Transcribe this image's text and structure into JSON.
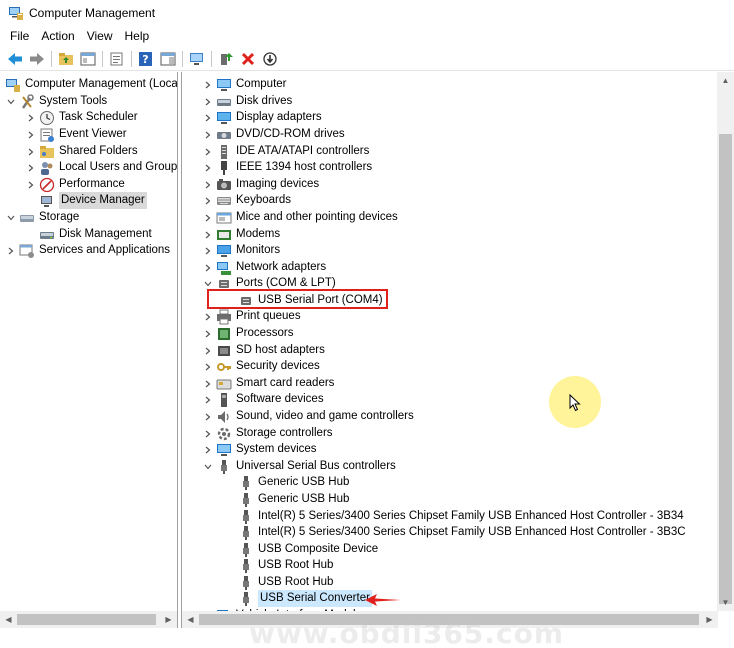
{
  "window": {
    "title": "Computer Management"
  },
  "menu": [
    "File",
    "Action",
    "View",
    "Help"
  ],
  "left_tree": {
    "root": "Computer Management (Local",
    "system_tools": "System Tools",
    "task_scheduler": "Task Scheduler",
    "event_viewer": "Event Viewer",
    "shared_folders": "Shared Folders",
    "local_users": "Local Users and Groups",
    "performance": "Performance",
    "device_manager": "Device Manager",
    "storage": "Storage",
    "disk_management": "Disk Management",
    "services": "Services and Applications"
  },
  "device_tree": {
    "computer": "Computer",
    "disk_drives": "Disk drives",
    "display_adapters": "Display adapters",
    "dvd": "DVD/CD-ROM drives",
    "ide": "IDE ATA/ATAPI controllers",
    "ieee": "IEEE 1394 host controllers",
    "imaging": "Imaging devices",
    "keyboards": "Keyboards",
    "mice": "Mice and other pointing devices",
    "modems": "Modems",
    "monitors": "Monitors",
    "network": "Network adapters",
    "ports": "Ports (COM & LPT)",
    "usb_serial_port": "USB Serial Port (COM4)",
    "print_queues": "Print queues",
    "processors": "Processors",
    "sd_host": "SD host adapters",
    "security": "Security devices",
    "smart_card": "Smart card readers",
    "software": "Software devices",
    "sound": "Sound, video and game controllers",
    "storage_controllers": "Storage controllers",
    "system_devices": "System devices",
    "usb_controllers": "Universal Serial Bus controllers",
    "generic_hub_1": "Generic USB Hub",
    "generic_hub_2": "Generic USB Hub",
    "intel_3b34": "Intel(R) 5 Series/3400 Series Chipset Family USB Enhanced Host Controller - 3B34",
    "intel_3b3c": "Intel(R) 5 Series/3400 Series Chipset Family USB Enhanced Host Controller - 3B3C",
    "usb_composite": "USB Composite Device",
    "usb_root_1": "USB Root Hub",
    "usb_root_2": "USB Root Hub",
    "usb_serial_converter": "USB Serial Converter",
    "vehicle": "Vehicle Interface Module"
  },
  "watermark": "www.obdii365.com",
  "colors": {
    "accent_red": "#e0201c",
    "selection_blue": "#cce8ff",
    "cursor_glow": "#fff078"
  }
}
